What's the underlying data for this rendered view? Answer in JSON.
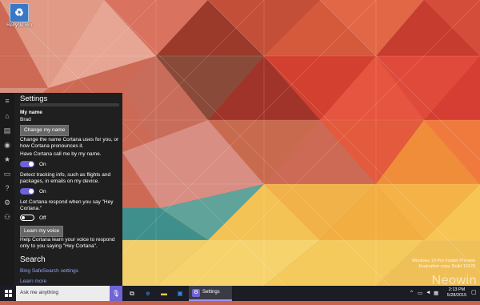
{
  "desktop": {
    "icon_label": "Recycle Bin",
    "watermark_line1": "Windows 10 Pro Insider Preview",
    "watermark_line2": "Evaluation copy. Build 10122",
    "brand_watermark": "Neowin"
  },
  "cortana": {
    "title": "Settings",
    "my_name_label": "My name",
    "my_name_value": "Brad",
    "change_name_button": "Change my name",
    "change_name_desc": "Change the name Cortana uses for you, or how Cortana pronounces it.",
    "call_me_label": "Have Cortana call me by my name.",
    "call_me_state": "On",
    "tracking_label": "Detect tracking info, such as flights and packages, in emails on my device.",
    "tracking_state": "On",
    "hey_cortana_label": "Let Cortana respond when you say \"Hey Cortana.\"",
    "hey_cortana_state": "Off",
    "learn_voice_button": "Learn my voice",
    "learn_voice_desc": "Help Cortana learn your voice to respond only to you saying \"Hey Cortana\".",
    "search_header": "Search",
    "safesearch_link": "Bing SafeSearch settings",
    "learn_more_link": "Learn more",
    "rail_icons": [
      "menu-icon",
      "home-icon",
      "notebook-icon",
      "lightbulb-icon",
      "star-icon",
      "feedback-icon",
      "question-icon",
      "gear-icon",
      "share-icon"
    ]
  },
  "taskbar": {
    "search_placeholder": "Ask me anything",
    "settings_label": "Settings",
    "time": "2:13 PM",
    "date": "5/28/2015"
  },
  "colors": {
    "accent": "#6f63d6",
    "panel": "#1f1f1f",
    "taskbar": "#1b1c24"
  }
}
